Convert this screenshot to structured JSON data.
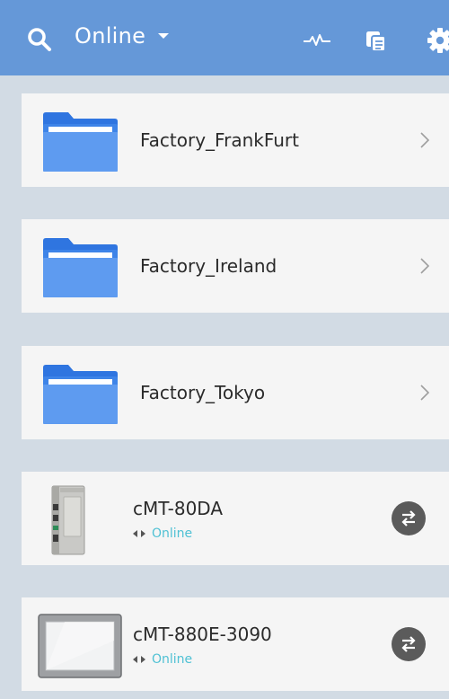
{
  "header": {
    "filter_label": "Online",
    "icons": [
      "search-icon",
      "chevron-down-icon",
      "pulse-icon",
      "copy-icon",
      "gear-icon"
    ]
  },
  "folders": [
    {
      "label": "Factory_FrankFurt",
      "icon": "folder-icon"
    },
    {
      "label": "Factory_Ireland",
      "icon": "folder-icon"
    },
    {
      "label": "Factory_Tokyo",
      "icon": "folder-icon"
    }
  ],
  "devices": [
    {
      "name": "cMT-80DA",
      "status": "Online",
      "icon": "device-module-icon"
    },
    {
      "name": "cMT-880E-3090",
      "status": "Online",
      "icon": "device-panel-icon"
    }
  ],
  "colors": {
    "header": "#6598d8",
    "background": "#d2dbe4",
    "card": "#f5f5f5",
    "online": "#4fc1d4",
    "connect_button": "#5b5b5b",
    "folder": "#3e84e8"
  }
}
